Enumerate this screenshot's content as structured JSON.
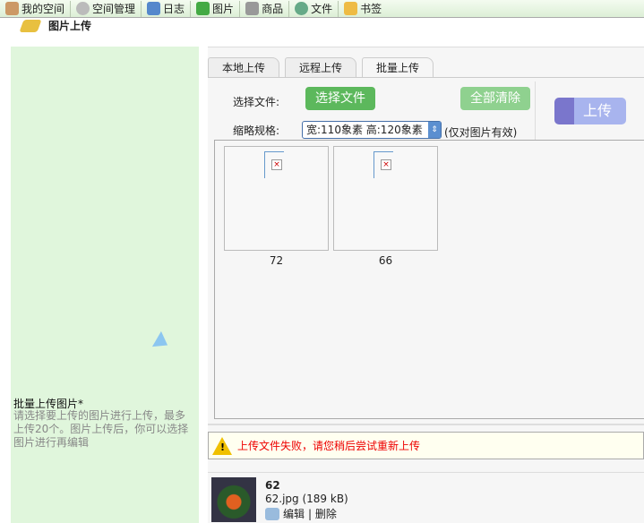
{
  "nav": [
    {
      "label": "我的空间",
      "icon": "home-icon",
      "color": "#c96"
    },
    {
      "label": "空间管理",
      "icon": "gear-icon",
      "color": "#bbb"
    },
    {
      "label": "日志",
      "icon": "blog-edit-icon",
      "color": "#58c"
    },
    {
      "label": "图片",
      "icon": "image-add-icon",
      "color": "#4a4"
    },
    {
      "label": "商品",
      "icon": "cart-icon",
      "color": "#999"
    },
    {
      "label": "文件",
      "icon": "file-globe-icon",
      "color": "#6a8"
    },
    {
      "label": "书签",
      "icon": "bookmark-star-icon",
      "color": "#eb4"
    }
  ],
  "page_title": "图片上传",
  "sidebar": {
    "heading": "批量上传图片*",
    "description": "请选择要上传的图片进行上传，最多上传20个。图片上传后，你可以选择图片进行再编辑"
  },
  "tabs": [
    {
      "label": "本地上传"
    },
    {
      "label": "远程上传"
    },
    {
      "label": "批量上传",
      "active": true
    }
  ],
  "form": {
    "select_file_label": "选择文件:",
    "select_file_button": "选择文件",
    "clear_all_button": "全部清除",
    "thumb_label": "缩略规格:",
    "thumb_value": "宽:110象素  高:120象素",
    "thumb_note": "(仅对图片有效)",
    "upload_button": "上传"
  },
  "thumbnails": [
    {
      "label": "72"
    },
    {
      "label": "66"
    }
  ],
  "error_message": "上传文件失败，请您稍后尝试重新上传",
  "file": {
    "name": "62",
    "info": "62.jpg (189 kB)",
    "edit": "编辑",
    "delete": "| 删除"
  }
}
